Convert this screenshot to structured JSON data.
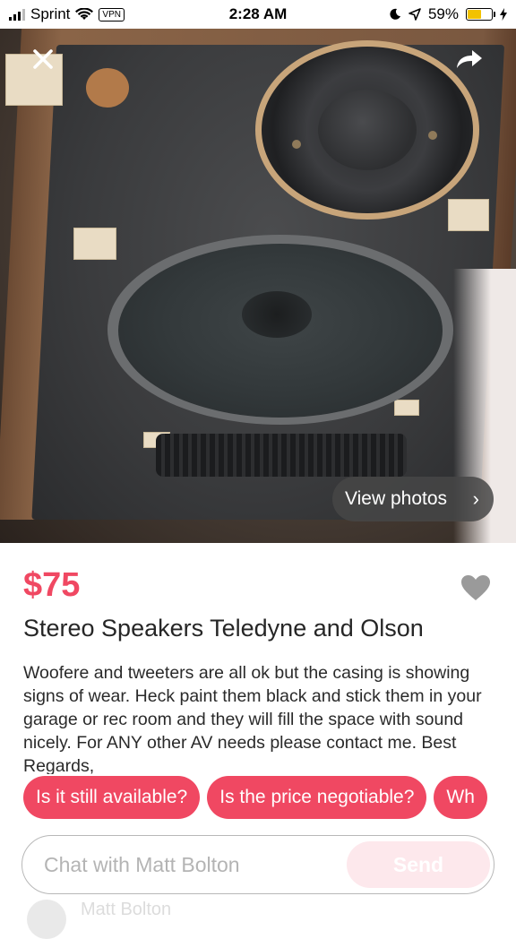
{
  "status_bar": {
    "carrier": "Sprint",
    "vpn": "VPN",
    "time": "2:28 AM",
    "battery": "59%",
    "battery_level": 0.59
  },
  "photo": {
    "view_photos_label": "View photos"
  },
  "listing": {
    "price": "$75",
    "title": "Stereo Speakers Teledyne and Olson",
    "description": "Woofere and tweeters are all ok but the casing is showing signs of wear. Heck paint them black and stick them in your garage or rec room and they will fill the space with sound nicely. For ANY other AV needs please contact me. Best Regards,"
  },
  "quick_replies": [
    "Is it still available?",
    "Is the price negotiable?",
    "Wh"
  ],
  "chat": {
    "placeholder": "Chat with Matt Bolton",
    "send_label": "Send"
  },
  "seller": {
    "name": "Matt Bolton"
  },
  "colors": {
    "accent": "#f04862",
    "send_disabled": "#fde8ec"
  }
}
